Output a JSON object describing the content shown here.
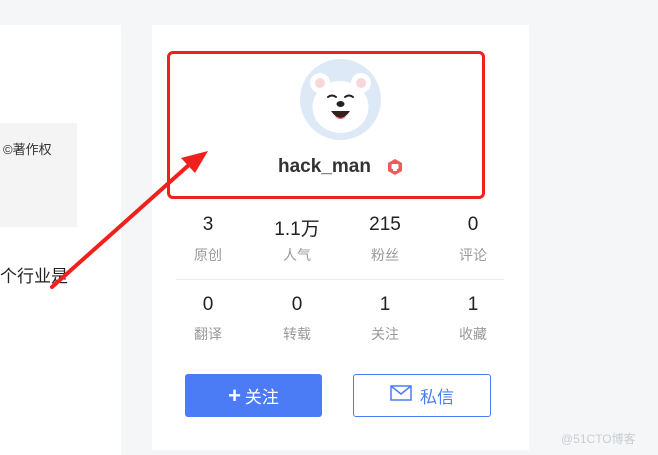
{
  "left_panel": {
    "copyright": "©著作权",
    "snippet": "个行业是"
  },
  "profile": {
    "username": "hack_man",
    "avatar_icon": "bear-avatar-icon",
    "badge_icon": "hexagon-badge-icon"
  },
  "stats": [
    {
      "value": "3",
      "label": "原创"
    },
    {
      "value": "1.1万",
      "label": "人气"
    },
    {
      "value": "215",
      "label": "粉丝"
    },
    {
      "value": "0",
      "label": "评论"
    },
    {
      "value": "0",
      "label": "翻译"
    },
    {
      "value": "0",
      "label": "转载"
    },
    {
      "value": "1",
      "label": "关注"
    },
    {
      "value": "1",
      "label": "收藏"
    }
  ],
  "actions": {
    "follow_label": "关注",
    "message_label": "私信"
  },
  "watermark": "@51CTO博客",
  "colors": {
    "accent": "#4b7bf5",
    "highlight": "#f0201c",
    "badge": "#f05a5a"
  }
}
